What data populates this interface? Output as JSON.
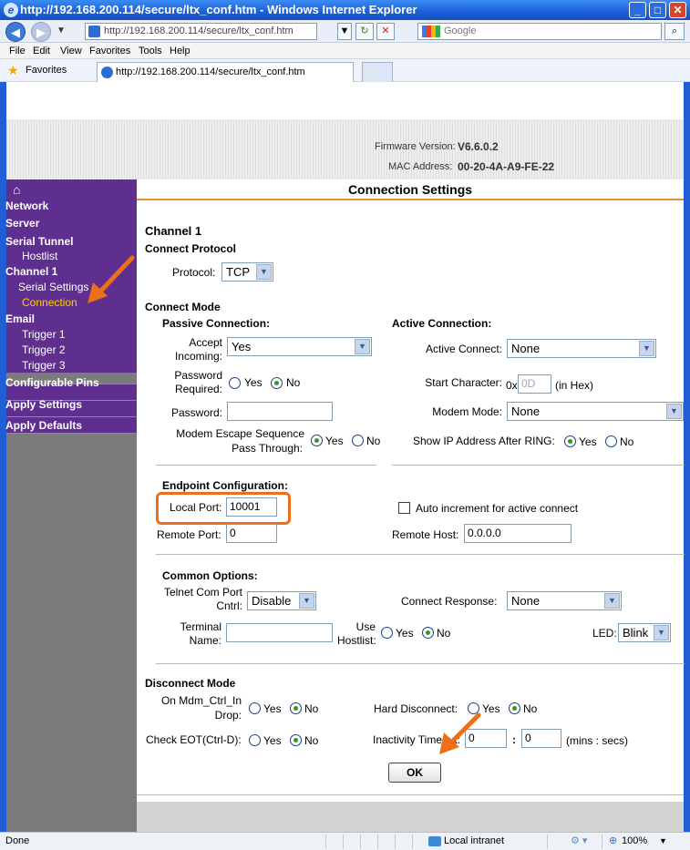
{
  "window": {
    "title": "http://192.168.200.114/secure/ltx_conf.htm - Windows Internet Explorer",
    "url": "http://192.168.200.114/secure/ltx_conf.htm",
    "tab_title": "http://192.168.200.114/secure/ltx_conf.htm",
    "search_placeholder": "Google",
    "favorites_label": "Favorites",
    "menu": [
      "File",
      "Edit",
      "View",
      "Favorites",
      "Tools",
      "Help"
    ]
  },
  "header": {
    "firmware_label": "Firmware Version:",
    "firmware_value": "V6.6.0.2",
    "mac_label": "MAC Address:",
    "mac_value": "00-20-4A-A9-FE-22"
  },
  "sidebar": {
    "items": [
      {
        "label": "Network"
      },
      {
        "label": "Server"
      },
      {
        "label": "Serial Tunnel"
      },
      {
        "label": "Hostlist"
      },
      {
        "label": "Channel 1"
      },
      {
        "label": "Serial Settings"
      },
      {
        "label": "Connection"
      },
      {
        "label": "Email"
      },
      {
        "label": "Trigger 1"
      },
      {
        "label": "Trigger 2"
      },
      {
        "label": "Trigger 3"
      },
      {
        "label": "Configurable Pins"
      },
      {
        "label": "Apply Settings"
      },
      {
        "label": "Apply Defaults"
      }
    ]
  },
  "main": {
    "title": "Connection Settings",
    "channel": "Channel 1",
    "connect_protocol": {
      "heading": "Connect Protocol",
      "protocol_label": "Protocol:",
      "protocol_value": "TCP"
    },
    "connect_mode": {
      "heading": "Connect Mode",
      "passive_heading": "Passive Connection:",
      "active_heading": "Active Connection:",
      "accept_incoming_label_1": "Accept",
      "accept_incoming_label_2": "Incoming:",
      "accept_incoming_value": "Yes",
      "password_required_label_1": "Password",
      "password_required_label_2": "Required:",
      "yes": "Yes",
      "no": "No",
      "password_label": "Password:",
      "password_value": "",
      "modem_escape_label_1": "Modem Escape Sequence",
      "modem_escape_label_2": "Pass Through:",
      "active_connect_label": "Active Connect:",
      "active_connect_value": "None",
      "start_char_label": "Start Character:",
      "start_char_prefix": "0x",
      "start_char_value": "0D",
      "start_char_suffix": "(in Hex)",
      "modem_mode_label": "Modem Mode:",
      "modem_mode_value": "None",
      "show_ip_label": "Show IP Address After RING:"
    },
    "endpoint": {
      "heading": "Endpoint Configuration:",
      "local_port_label": "Local Port:",
      "local_port_value": "10001",
      "auto_increment_label": "Auto increment for active connect",
      "remote_port_label": "Remote Port:",
      "remote_port_value": "0",
      "remote_host_label": "Remote Host:",
      "remote_host_value": "0.0.0.0"
    },
    "common": {
      "heading": "Common Options:",
      "telnet_label_1": "Telnet Com Port",
      "telnet_label_2": "Cntrl:",
      "telnet_value": "Disable",
      "connect_response_label": "Connect Response:",
      "connect_response_value": "None",
      "terminal_label_1": "Terminal",
      "terminal_label_2": "Name:",
      "terminal_value": "",
      "use_hostlist_label_1": "Use",
      "use_hostlist_label_2": "Hostlist:",
      "led_label": "LED:",
      "led_value": "Blink"
    },
    "disconnect": {
      "heading": "Disconnect Mode",
      "on_mdm_label_1": "On Mdm_Ctrl_In",
      "on_mdm_label_2": "Drop:",
      "hard_disconnect_label": "Hard Disconnect:",
      "check_eot_label": "Check EOT(Ctrl-D):",
      "inactivity_label": "Inactivity Timeout:",
      "inactivity_mins": "0",
      "inactivity_secs": "0",
      "colon": ":",
      "units": "(mins : secs)"
    },
    "ok_label": "OK"
  },
  "status": {
    "text": "Done",
    "zone": "Local intranet",
    "zoom": "100%"
  },
  "colors": {
    "sidebar_purple": "#5f2f8f",
    "highlight_orange": "#ee6f1a",
    "sidebar_current": "#ffcc00"
  }
}
